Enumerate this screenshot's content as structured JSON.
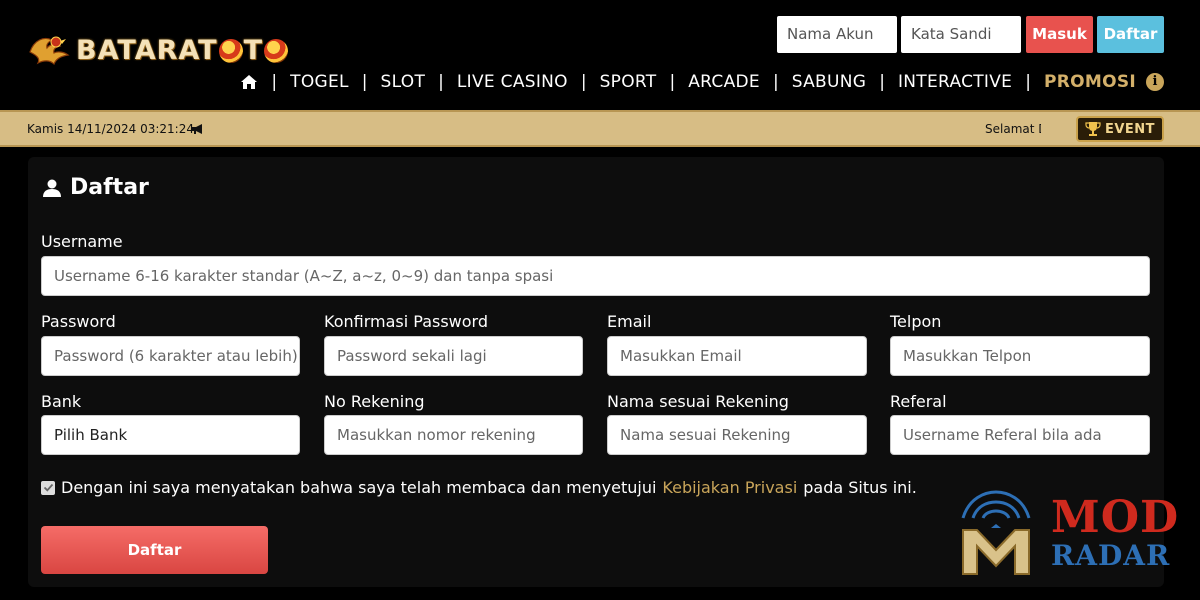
{
  "brand": {
    "logo_text": "BATARATOTO",
    "accent": "#d4b06a"
  },
  "login": {
    "username_placeholder": "Nama Akun",
    "password_placeholder": "Kata Sandi",
    "login_label": "Masuk",
    "register_label": "Daftar"
  },
  "nav": {
    "items": [
      "TOGEL",
      "SLOT",
      "LIVE CASINO",
      "SPORT",
      "ARCADE",
      "SABUNG",
      "INTERACTIVE",
      "PROMOSI"
    ]
  },
  "ticker": {
    "datetime": "Kamis 14/11/2024 03:21:24",
    "marquee_text": "Selamat D",
    "event_label": "EVENT"
  },
  "form": {
    "title": "Daftar",
    "username_label": "Username",
    "username_placeholder": "Username 6-16 karakter standar (A~Z, a~z, 0~9) dan tanpa spasi",
    "password_label": "Password",
    "password_placeholder": "Password (6 karakter atau lebih)",
    "confirm_label": "Konfirmasi Password",
    "confirm_placeholder": "Password sekali lagi",
    "email_label": "Email",
    "email_placeholder": "Masukkan Email",
    "phone_label": "Telpon",
    "phone_placeholder": "Masukkan Telpon",
    "bank_label": "Bank",
    "bank_value": "Pilih Bank",
    "account_label": "No Rekening",
    "account_placeholder": "Masukkan nomor rekening",
    "account_name_label": "Nama sesuai Rekening",
    "account_name_placeholder": "Nama sesuai Rekening",
    "referral_label": "Referal",
    "referral_placeholder": "Username Referal bila ada",
    "agree_prefix": "Dengan ini saya menyatakan bahwa saya telah membaca dan menyetujui",
    "agree_link": "Kebijakan Privasi",
    "agree_suffix": "pada Situs ini.",
    "agree_checked": true,
    "submit_label": "Daftar"
  },
  "watermark": {
    "line1": "MOD",
    "line2": "RADAR"
  },
  "colors": {
    "ticker_bg": "#d7bd85",
    "login_button": "#e8524e",
    "register_button": "#5bc0de",
    "submit_button": "#e8524e",
    "promo": "#d4b06a"
  }
}
